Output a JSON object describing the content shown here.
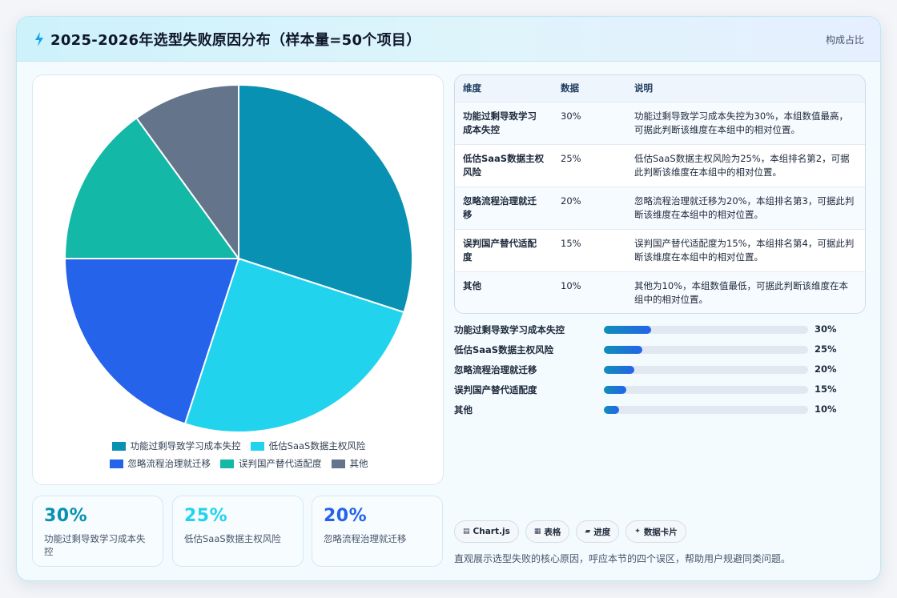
{
  "header": {
    "title": "2025-2026年选型失败原因分布（样本量=50个项目）",
    "tag": "构成占比",
    "icon": "sparkle-icon"
  },
  "colors": {
    "accent": "#0891b2",
    "series": [
      "#0891b2",
      "#22d3ee",
      "#2563eb",
      "#14b8a6",
      "#64748b"
    ]
  },
  "chart_data": {
    "type": "pie",
    "labels": [
      "功能过剩导致学习成本失控",
      "低估SaaS数据主权风险",
      "忽略流程治理就迁移",
      "误判国产替代适配度",
      "其他"
    ],
    "values": [
      30,
      25,
      20,
      15,
      10
    ],
    "unit": "%",
    "title": "",
    "legend": "bottom"
  },
  "stats": [
    {
      "value": "30%",
      "label": "功能过剩导致学习成本失控",
      "color": "#0891b2"
    },
    {
      "value": "25%",
      "label": "低估SaaS数据主权风险",
      "color": "#22d3ee"
    },
    {
      "value": "20%",
      "label": "忽略流程治理就迁移",
      "color": "#2563eb"
    }
  ],
  "table": {
    "headers": [
      "维度",
      "数据",
      "说明"
    ],
    "rows": [
      [
        "功能过剩导致学习成本失控",
        "30%",
        "功能过剩导致学习成本失控为30%，本组数值最高，可据此判断该维度在本组中的相对位置。"
      ],
      [
        "低估SaaS数据主权风险",
        "25%",
        "低估SaaS数据主权风险为25%，本组排名第2，可据此判断该维度在本组中的相对位置。"
      ],
      [
        "忽略流程治理就迁移",
        "20%",
        "忽略流程治理就迁移为20%，本组排名第3，可据此判断该维度在本组中的相对位置。"
      ],
      [
        "误判国产替代适配度",
        "15%",
        "误判国产替代适配度为15%，本组排名第4，可据此判断该维度在本组中的相对位置。"
      ],
      [
        "其他",
        "10%",
        "其他为10%，本组数值最低，可据此判断该维度在本组中的相对位置。"
      ]
    ]
  },
  "bars": [
    {
      "label": "功能过剩导致学习成本失控",
      "pct": "30%",
      "fraction": 0.23
    },
    {
      "label": "低估SaaS数据主权风险",
      "pct": "25%",
      "fraction": 0.19
    },
    {
      "label": "忽略流程治理就迁移",
      "pct": "20%",
      "fraction": 0.15
    },
    {
      "label": "误判国产替代适配度",
      "pct": "15%",
      "fraction": 0.11
    },
    {
      "label": "其他",
      "pct": "10%",
      "fraction": 0.075
    }
  ],
  "chips": [
    {
      "icon": "table-icon",
      "glyph": "▤",
      "label": "Chart.js"
    },
    {
      "icon": "grid-icon",
      "glyph": "▦",
      "label": "表格"
    },
    {
      "icon": "progress-icon",
      "glyph": "▰",
      "label": "进度"
    },
    {
      "icon": "star-icon",
      "glyph": "✦",
      "label": "数据卡片"
    }
  ],
  "footer_note": "直观展示选型失败的核心原因，呼应本节的四个误区，帮助用户规避同类问题。"
}
